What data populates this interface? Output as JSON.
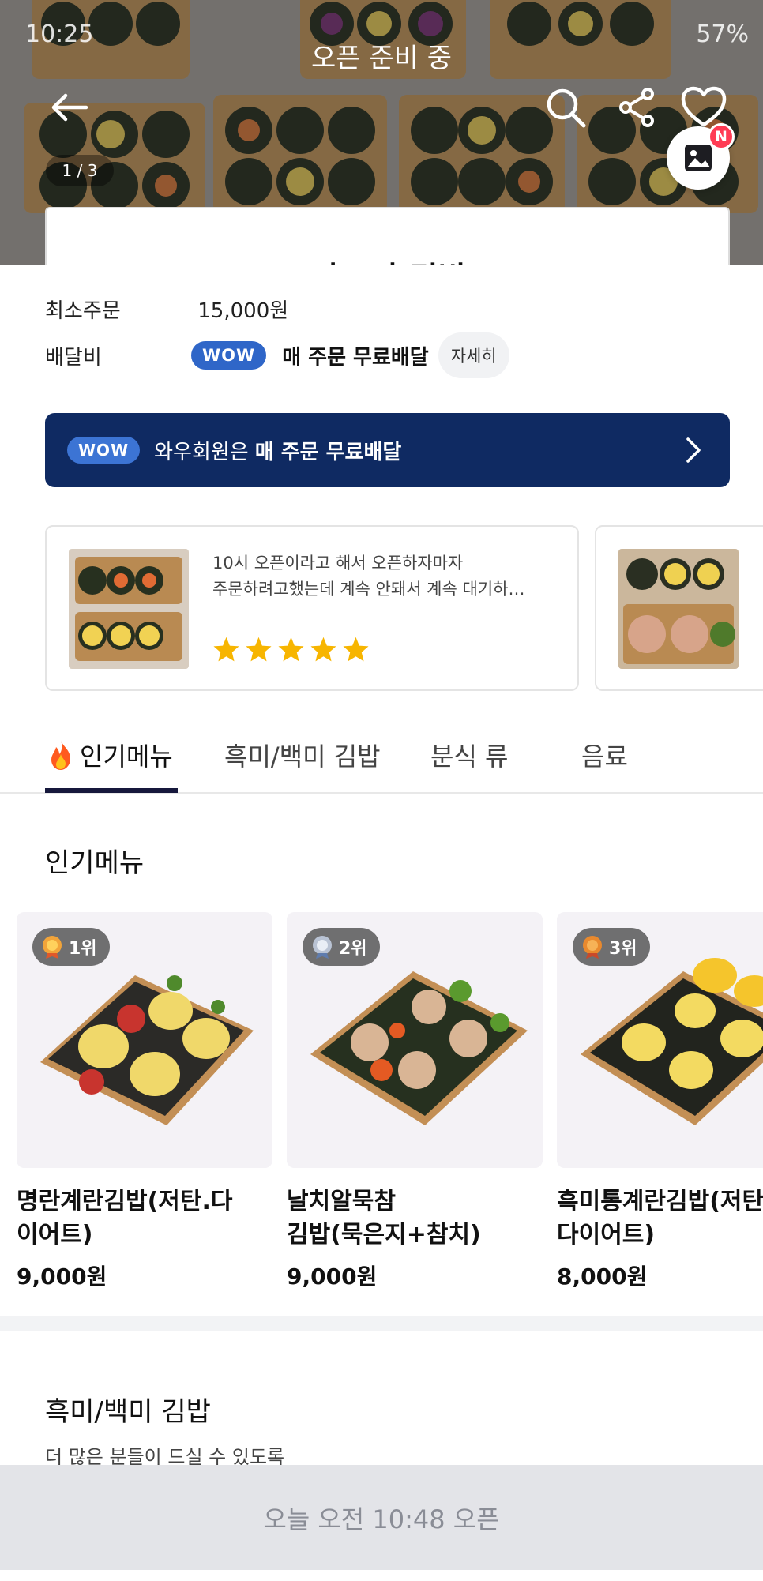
{
  "status_bar": {
    "time": "10:25",
    "battery": "57%"
  },
  "header": {
    "title": "오픈 준비 중",
    "photo_counter": "1 / 3",
    "photo_badge": "N"
  },
  "store": {
    "name": "사모의 김밥"
  },
  "info": {
    "min_order_label": "최소주문",
    "min_order_value": "15,000원",
    "delivery_fee_label": "배달비",
    "wow_label": "WOW",
    "delivery_fee_value": "매 주문 무료배달",
    "detail_button": "자세히"
  },
  "wow_banner": {
    "badge": "WOW",
    "text": "와우회원은",
    "bold": "매 주문 무료배달"
  },
  "reviews": [
    {
      "line1": "10시 오픈이라고 해서 오픈하자마자",
      "line2": "주문하려고했는데 계속 안돼서 계속 대기하…",
      "rating": 5
    }
  ],
  "tabs": [
    {
      "label": "인기메뉴",
      "active": true
    },
    {
      "label": "흑미/백미 김밥",
      "active": false
    },
    {
      "label": "분식 류",
      "active": false
    },
    {
      "label": "음료",
      "active": false
    }
  ],
  "popular": {
    "title": "인기메뉴",
    "items": [
      {
        "rank": "1위",
        "name": "명란계란김밥(저탄.다\n이어트)",
        "price": "9,000원"
      },
      {
        "rank": "2위",
        "name": "날치알묵참\n김밥(묵은지+참치)",
        "price": "9,000원"
      },
      {
        "rank": "3위",
        "name": "흑미통계란김밥(저탄\n다이어트)",
        "price": "8,000원"
      }
    ]
  },
  "kimbap_section": {
    "title": "흑미/백미 김밥",
    "description": "더 많은 분들이 드실 수 있도록"
  },
  "bottom_bar": {
    "text": "오늘 오전 10:48 오픈"
  },
  "colors": {
    "navy": "#0f2a62",
    "wow_blue": "#2f66c8",
    "star": "#f7b500",
    "tab_indicator": "#16183c",
    "badge_red": "#ff3b54"
  },
  "icons": [
    "back-arrow-icon",
    "search-icon",
    "share-icon",
    "heart-icon",
    "photo-icon",
    "chevron-right-icon",
    "star-icon",
    "fire-icon",
    "medal-icon"
  ]
}
